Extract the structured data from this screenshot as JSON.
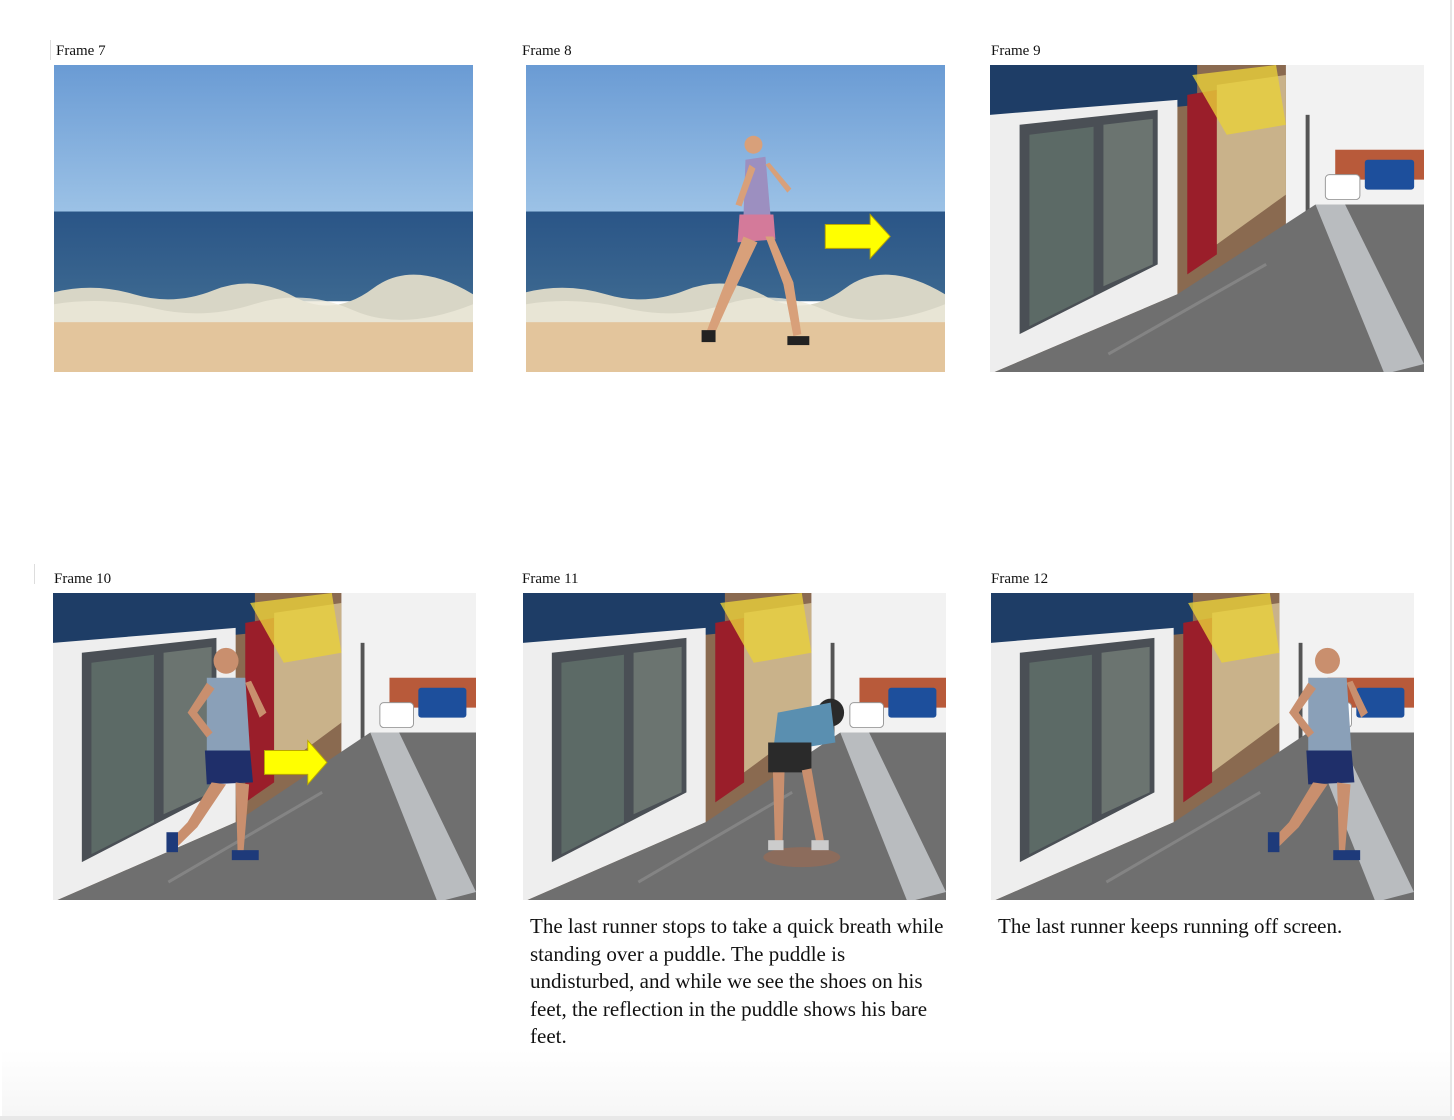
{
  "frames": [
    {
      "label": "Frame 7",
      "scene": "beach",
      "figure": "none",
      "arrow": false
    },
    {
      "label": "Frame 8",
      "scene": "beach",
      "figure": "woman-running",
      "arrow": true
    },
    {
      "label": "Frame 9",
      "scene": "street",
      "figure": "none",
      "arrow": false
    },
    {
      "label": "Frame 10",
      "scene": "street",
      "figure": "man-running",
      "arrow": true
    },
    {
      "label": "Frame 11",
      "scene": "street",
      "figure": "man-bent-over",
      "arrow": false,
      "caption": "The last runner stops to take a quick breath while standing over a puddle. The puddle is undisturbed, and while we see the shoes on his feet, the reflection in the puddle shows his bare feet."
    },
    {
      "label": "Frame 12",
      "scene": "street",
      "figure": "man-running",
      "arrow": false,
      "caption": "The last runner keeps running off screen."
    }
  ],
  "colors": {
    "arrow": "#ffff00",
    "sky": "#6fa1d8",
    "sea": "#2f5a8a",
    "sand": "#e3c59c"
  }
}
